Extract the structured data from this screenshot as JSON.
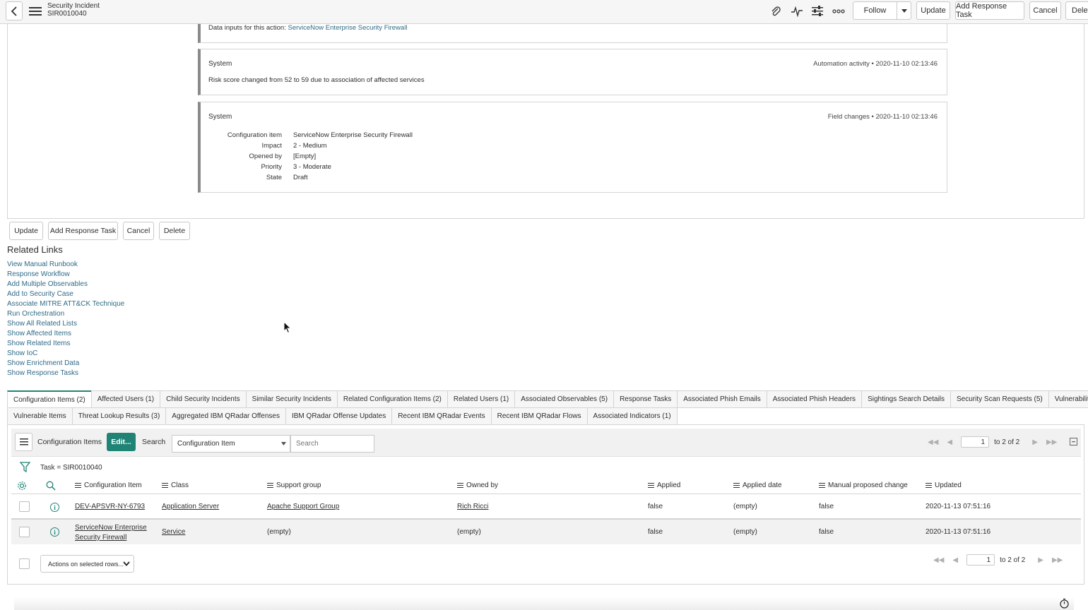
{
  "header": {
    "title": "Security Incident",
    "number": "SIR0010040",
    "buttons": {
      "follow": "Follow",
      "update": "Update",
      "add_response_task": "Add Response Task",
      "cancel": "Cancel",
      "delete_cut": "Delet"
    }
  },
  "activity": {
    "partial_line_prefix": "Data inputs for this action: ",
    "partial_line_link": "ServiceNow Enterprise Security Firewall",
    "cards": [
      {
        "who": "System",
        "meta": "Automation activity  •  2020-11-10 02:13:46",
        "body": "Risk score changed from 52 to 59 due to association of affected services"
      },
      {
        "who": "System",
        "meta": "Field changes  •  2020-11-10 02:13:46",
        "fields": [
          {
            "label": "Configuration item",
            "value": "ServiceNow Enterprise Security Firewall"
          },
          {
            "label": "Impact",
            "value": "2 - Medium"
          },
          {
            "label": "Opened by",
            "value": "[Empty]"
          },
          {
            "label": "Priority",
            "value": "3 - Moderate"
          },
          {
            "label": "State",
            "value": "Draft"
          }
        ]
      }
    ]
  },
  "form_buttons": {
    "update": "Update",
    "add_response_task": "Add Response Task",
    "cancel": "Cancel",
    "delete": "Delete"
  },
  "related_links": {
    "title": "Related Links",
    "items": [
      "View Manual Runbook",
      "Response Workflow",
      "Add Multiple Observables",
      "Add to Security Case",
      "Associate MITRE ATT&CK Technique",
      "Run Orchestration",
      "Show All Related Lists",
      "Show Affected Items",
      "Show Related Items",
      "Show IoC",
      "Show Enrichment Data",
      "Show Response Tasks"
    ]
  },
  "tabs_row1": [
    "Configuration Items (2)",
    "Affected Users (1)",
    "Child Security Incidents",
    "Similar Security Incidents",
    "Related Configuration Items (2)",
    "Related Users (1)",
    "Associated Observables (5)",
    "Response Tasks",
    "Associated Phish Emails",
    "Associated Phish Headers",
    "Sightings Search Details",
    "Security Scan Requests (5)",
    "Vulnerability Groups"
  ],
  "tabs_row2": [
    "Vulnerable Items",
    "Threat Lookup Results (3)",
    "Aggregated IBM QRadar Offenses",
    "IBM QRadar Offense Updates",
    "Recent IBM QRadar Events",
    "Recent IBM QRadar Flows",
    "Associated Indicators (1)"
  ],
  "list": {
    "title": "Configuration Items",
    "edit": "Edit...",
    "search_label": "Search",
    "search_field": "Configuration Item",
    "search_placeholder": "Search",
    "page": "1",
    "page_of": "to 2 of 2",
    "filter": "Task = SIR0010040",
    "columns": [
      "Configuration Item",
      "Class",
      "Support group",
      "Owned by",
      "Applied",
      "Applied date",
      "Manual proposed change",
      "Updated"
    ],
    "rows": [
      {
        "ci": "DEV-APSVR-NY-6793",
        "ci2": "",
        "class": "Application Server",
        "support": "Apache Support Group",
        "owned": "Rich Ricci",
        "applied": "false",
        "applied_date": "(empty)",
        "manual": "false",
        "updated": "2020-11-13 07:51:16"
      },
      {
        "ci": "ServiceNow Enterprise",
        "ci2": "Security Firewall",
        "class": "Service",
        "support": "(empty)",
        "owned": "(empty)",
        "applied": "false",
        "applied_date": "(empty)",
        "manual": "false",
        "updated": "2020-11-13 07:51:16"
      }
    ],
    "actions": "Actions on selected rows..."
  },
  "colors": {
    "accent": "#1f8476",
    "link": "#2e6b87"
  }
}
